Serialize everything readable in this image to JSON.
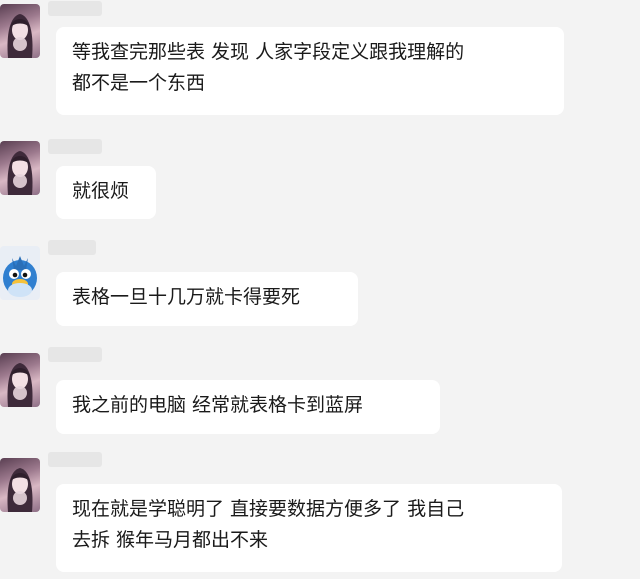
{
  "messages": [
    {
      "avatar": "girl-avatar",
      "lines": [
        "等我查完那些表  发现  人家字段定义跟我理解的",
        "都不是一个东西"
      ]
    },
    {
      "avatar": "girl-avatar",
      "lines": [
        "就很烦"
      ]
    },
    {
      "avatar": "blue-bird-avatar",
      "lines": [
        "表格一旦十几万就卡得要死"
      ]
    },
    {
      "avatar": "girl-avatar",
      "lines": [
        "我之前的电脑  经常就表格卡到蓝屏"
      ]
    },
    {
      "avatar": "girl-avatar",
      "lines": [
        "现在就是学聪明了  直接要数据方便多了  我自己",
        "去拆  猴年马月都出不来"
      ]
    }
  ]
}
